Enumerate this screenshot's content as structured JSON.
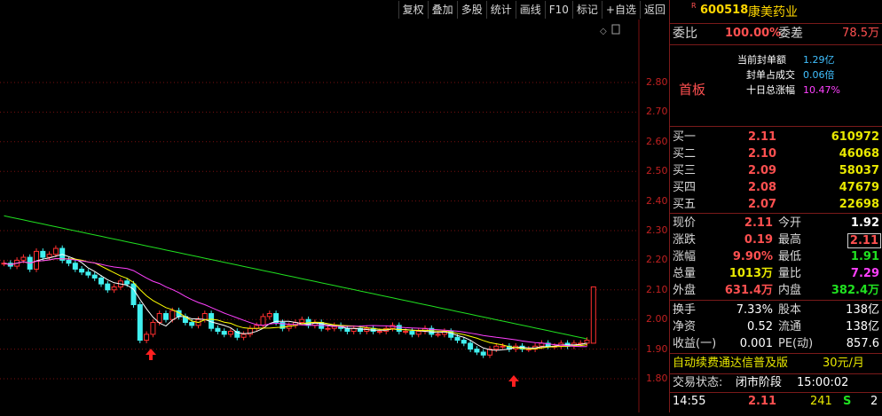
{
  "toolbar": {
    "buttons": [
      "复权",
      "叠加",
      "多股",
      "统计",
      "画线",
      "F10",
      "标记",
      "+自选",
      "返回"
    ]
  },
  "axis": {
    "ticks": [
      "2.80",
      "2.70",
      "2.60",
      "2.50",
      "2.40",
      "2.30",
      "2.20",
      "2.10",
      "2.00",
      "1.90",
      "1.80"
    ]
  },
  "stock": {
    "marker": "R",
    "code": "600518",
    "name": "康美药业"
  },
  "ratio": {
    "weibi_label": "委比",
    "weibi_value": "100.00%",
    "weicha_label": "委差",
    "weicha_value": "78.5万"
  },
  "limit": {
    "tag": "首板",
    "seal_amount_label": "当前封单额",
    "seal_amount_value": "1.29亿",
    "seal_ratio_label": "封单占成交",
    "seal_ratio_value": "0.06倍",
    "tenday_label": "十日总涨幅",
    "tenday_value": "10.47%"
  },
  "bids": [
    {
      "label": "买一",
      "price": "2.11",
      "vol": "610972"
    },
    {
      "label": "买二",
      "price": "2.10",
      "vol": "46068"
    },
    {
      "label": "买三",
      "price": "2.09",
      "vol": "58037"
    },
    {
      "label": "买四",
      "price": "2.08",
      "vol": "47679"
    },
    {
      "label": "买五",
      "price": "2.07",
      "vol": "22698"
    }
  ],
  "quote": {
    "xj_label": "现价",
    "xj_value": "2.11",
    "jk_label": "今开",
    "jk_value": "1.92",
    "zd_label": "涨跌",
    "zd_value": "0.19",
    "zg_label": "最高",
    "zg_value": "2.11",
    "zf_label": "涨幅",
    "zf_value": "9.90%",
    "zd2_label": "最低",
    "zd2_value": "1.91",
    "zl_label": "总量",
    "zl_value": "1013万",
    "lb_label": "量比",
    "lb_value": "7.29",
    "wp_label": "外盘",
    "wp_value": "631.4万",
    "np_label": "内盘",
    "np_value": "382.4万"
  },
  "fund": {
    "hs_label": "换手",
    "hs_value": "7.33%",
    "gb_label": "股本",
    "gb_value": "138亿",
    "jz_label": "净资",
    "jz_value": "0.52",
    "lt_label": "流通",
    "lt_value": "138亿",
    "sy_label": "收益(一)",
    "sy_value": "0.001",
    "pe_label": "PE(动)",
    "pe_value": "857.6"
  },
  "ad": {
    "text": "自动续费通达信普及版",
    "price": "30元/月"
  },
  "status": {
    "label": "交易状态:",
    "value": "闭市阶段",
    "time": "15:00:02"
  },
  "ticks_list": [
    {
      "time": "14:55",
      "price": "2.11",
      "vol": "241",
      "side": "S",
      "n": "2"
    }
  ]
}
